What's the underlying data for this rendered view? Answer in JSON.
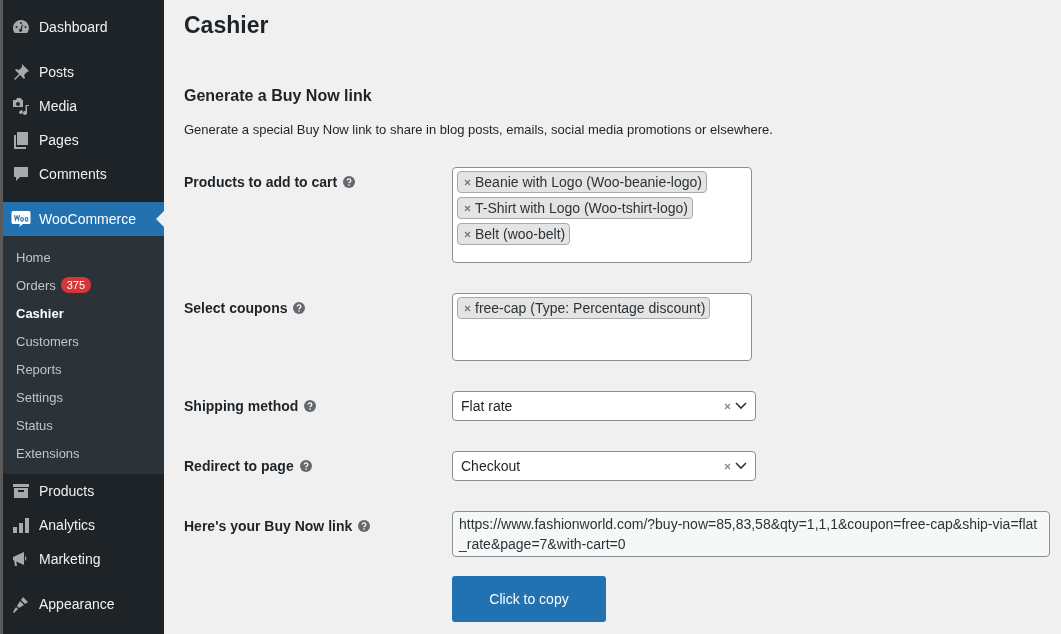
{
  "sidebar": {
    "items": [
      {
        "kind": "item",
        "label": "Dashboard",
        "selected": false
      },
      {
        "kind": "separator"
      },
      {
        "kind": "item",
        "label": "Posts",
        "selected": false
      },
      {
        "kind": "item",
        "label": "Media",
        "selected": false
      },
      {
        "kind": "item",
        "label": "Pages",
        "selected": false
      },
      {
        "kind": "item",
        "label": "Comments",
        "selected": false
      },
      {
        "kind": "separator"
      },
      {
        "kind": "item",
        "label": "WooCommerce",
        "selected": true,
        "children": [
          {
            "label": "Home",
            "selected": false
          },
          {
            "label": "Orders",
            "badge": "375",
            "selected": false
          },
          {
            "label": "Cashier",
            "selected": true
          },
          {
            "label": "Customers",
            "selected": false
          },
          {
            "label": "Reports",
            "selected": false
          },
          {
            "label": "Settings",
            "selected": false
          },
          {
            "label": "Status",
            "selected": false
          },
          {
            "label": "Extensions",
            "selected": false
          }
        ]
      },
      {
        "kind": "item",
        "label": "Products",
        "selected": false
      },
      {
        "kind": "item",
        "label": "Analytics",
        "selected": false
      },
      {
        "kind": "item",
        "label": "Marketing",
        "selected": false
      },
      {
        "kind": "separator"
      },
      {
        "kind": "item",
        "label": "Appearance",
        "selected": false
      }
    ]
  },
  "page": {
    "title": "Cashier",
    "heading": "Generate a Buy Now link",
    "description": "Generate a special Buy Now link to share in blog posts, emails, social media promotions or elsewhere."
  },
  "form": {
    "fields": [
      {
        "kind": "tags",
        "label": "Products to add to cart",
        "tags": [
          "Beanie with Logo (Woo-beanie-logo)",
          "T-Shirt with Logo (Woo-tshirt-logo)",
          "Belt (woo-belt)"
        ]
      },
      {
        "kind": "tags",
        "label": "Select coupons",
        "tags": [
          "free-cap (Type: Percentage discount)"
        ]
      },
      {
        "kind": "select",
        "label": "Shipping method",
        "value": "Flat rate"
      },
      {
        "kind": "select",
        "label": "Redirect to page",
        "value": "Checkout"
      },
      {
        "kind": "textarea",
        "label": "Here's your Buy Now link",
        "value": "https://www.fashionworld.com/?buy-now=85,83,58&qty=1,1,1&coupon=free-cap&ship-via=flat_rate&page=7&with-cart=0"
      }
    ],
    "button": "Click to copy"
  }
}
